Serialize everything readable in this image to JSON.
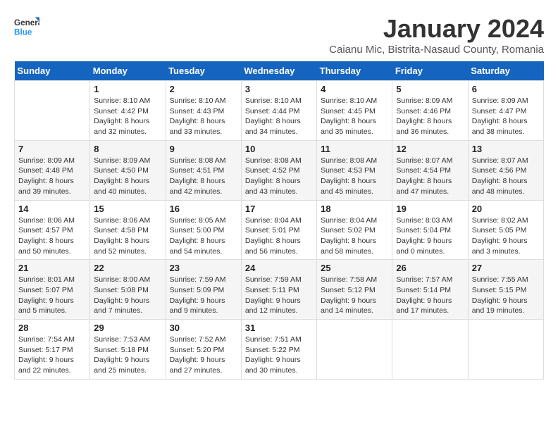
{
  "header": {
    "logo_line1": "General",
    "logo_line2": "Blue",
    "month": "January 2024",
    "location": "Caianu Mic, Bistrita-Nasaud County, Romania"
  },
  "weekdays": [
    "Sunday",
    "Monday",
    "Tuesday",
    "Wednesday",
    "Thursday",
    "Friday",
    "Saturday"
  ],
  "weeks": [
    [
      {
        "day": "",
        "detail": ""
      },
      {
        "day": "1",
        "detail": "Sunrise: 8:10 AM\nSunset: 4:42 PM\nDaylight: 8 hours\nand 32 minutes."
      },
      {
        "day": "2",
        "detail": "Sunrise: 8:10 AM\nSunset: 4:43 PM\nDaylight: 8 hours\nand 33 minutes."
      },
      {
        "day": "3",
        "detail": "Sunrise: 8:10 AM\nSunset: 4:44 PM\nDaylight: 8 hours\nand 34 minutes."
      },
      {
        "day": "4",
        "detail": "Sunrise: 8:10 AM\nSunset: 4:45 PM\nDaylight: 8 hours\nand 35 minutes."
      },
      {
        "day": "5",
        "detail": "Sunrise: 8:09 AM\nSunset: 4:46 PM\nDaylight: 8 hours\nand 36 minutes."
      },
      {
        "day": "6",
        "detail": "Sunrise: 8:09 AM\nSunset: 4:47 PM\nDaylight: 8 hours\nand 38 minutes."
      }
    ],
    [
      {
        "day": "7",
        "detail": "Sunrise: 8:09 AM\nSunset: 4:48 PM\nDaylight: 8 hours\nand 39 minutes."
      },
      {
        "day": "8",
        "detail": "Sunrise: 8:09 AM\nSunset: 4:50 PM\nDaylight: 8 hours\nand 40 minutes."
      },
      {
        "day": "9",
        "detail": "Sunrise: 8:08 AM\nSunset: 4:51 PM\nDaylight: 8 hours\nand 42 minutes."
      },
      {
        "day": "10",
        "detail": "Sunrise: 8:08 AM\nSunset: 4:52 PM\nDaylight: 8 hours\nand 43 minutes."
      },
      {
        "day": "11",
        "detail": "Sunrise: 8:08 AM\nSunset: 4:53 PM\nDaylight: 8 hours\nand 45 minutes."
      },
      {
        "day": "12",
        "detail": "Sunrise: 8:07 AM\nSunset: 4:54 PM\nDaylight: 8 hours\nand 47 minutes."
      },
      {
        "day": "13",
        "detail": "Sunrise: 8:07 AM\nSunset: 4:56 PM\nDaylight: 8 hours\nand 48 minutes."
      }
    ],
    [
      {
        "day": "14",
        "detail": "Sunrise: 8:06 AM\nSunset: 4:57 PM\nDaylight: 8 hours\nand 50 minutes."
      },
      {
        "day": "15",
        "detail": "Sunrise: 8:06 AM\nSunset: 4:58 PM\nDaylight: 8 hours\nand 52 minutes."
      },
      {
        "day": "16",
        "detail": "Sunrise: 8:05 AM\nSunset: 5:00 PM\nDaylight: 8 hours\nand 54 minutes."
      },
      {
        "day": "17",
        "detail": "Sunrise: 8:04 AM\nSunset: 5:01 PM\nDaylight: 8 hours\nand 56 minutes."
      },
      {
        "day": "18",
        "detail": "Sunrise: 8:04 AM\nSunset: 5:02 PM\nDaylight: 8 hours\nand 58 minutes."
      },
      {
        "day": "19",
        "detail": "Sunrise: 8:03 AM\nSunset: 5:04 PM\nDaylight: 9 hours\nand 0 minutes."
      },
      {
        "day": "20",
        "detail": "Sunrise: 8:02 AM\nSunset: 5:05 PM\nDaylight: 9 hours\nand 3 minutes."
      }
    ],
    [
      {
        "day": "21",
        "detail": "Sunrise: 8:01 AM\nSunset: 5:07 PM\nDaylight: 9 hours\nand 5 minutes."
      },
      {
        "day": "22",
        "detail": "Sunrise: 8:00 AM\nSunset: 5:08 PM\nDaylight: 9 hours\nand 7 minutes."
      },
      {
        "day": "23",
        "detail": "Sunrise: 7:59 AM\nSunset: 5:09 PM\nDaylight: 9 hours\nand 9 minutes."
      },
      {
        "day": "24",
        "detail": "Sunrise: 7:59 AM\nSunset: 5:11 PM\nDaylight: 9 hours\nand 12 minutes."
      },
      {
        "day": "25",
        "detail": "Sunrise: 7:58 AM\nSunset: 5:12 PM\nDaylight: 9 hours\nand 14 minutes."
      },
      {
        "day": "26",
        "detail": "Sunrise: 7:57 AM\nSunset: 5:14 PM\nDaylight: 9 hours\nand 17 minutes."
      },
      {
        "day": "27",
        "detail": "Sunrise: 7:55 AM\nSunset: 5:15 PM\nDaylight: 9 hours\nand 19 minutes."
      }
    ],
    [
      {
        "day": "28",
        "detail": "Sunrise: 7:54 AM\nSunset: 5:17 PM\nDaylight: 9 hours\nand 22 minutes."
      },
      {
        "day": "29",
        "detail": "Sunrise: 7:53 AM\nSunset: 5:18 PM\nDaylight: 9 hours\nand 25 minutes."
      },
      {
        "day": "30",
        "detail": "Sunrise: 7:52 AM\nSunset: 5:20 PM\nDaylight: 9 hours\nand 27 minutes."
      },
      {
        "day": "31",
        "detail": "Sunrise: 7:51 AM\nSunset: 5:22 PM\nDaylight: 9 hours\nand 30 minutes."
      },
      {
        "day": "",
        "detail": ""
      },
      {
        "day": "",
        "detail": ""
      },
      {
        "day": "",
        "detail": ""
      }
    ]
  ]
}
